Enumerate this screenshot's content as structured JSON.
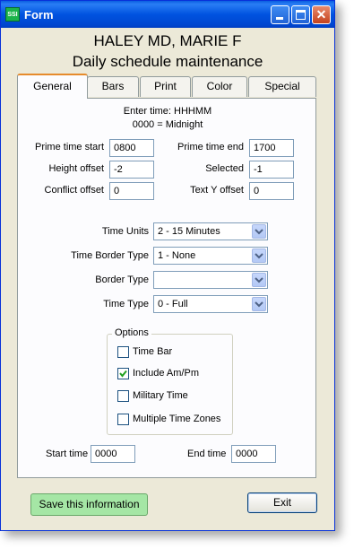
{
  "window": {
    "title": "Form",
    "app_icon": "SSI"
  },
  "header": {
    "patient": "HALEY MD, MARIE F",
    "screen": "Daily schedule maintenance"
  },
  "tabs": [
    "General",
    "Bars",
    "Print",
    "Color",
    "Special"
  ],
  "active_tab": "General",
  "instructions": {
    "line1": "Enter time: HHHMM",
    "line2": "0000 = Midnight"
  },
  "fields": {
    "prime_start": {
      "label": "Prime time start",
      "value": "0800"
    },
    "prime_end": {
      "label": "Prime time end",
      "value": "1700"
    },
    "height_offset": {
      "label": "Height offset",
      "value": "-2"
    },
    "selected": {
      "label": "Selected",
      "value": "-1"
    },
    "conflict_offset": {
      "label": "Conflict offset",
      "value": "0"
    },
    "text_y_offset": {
      "label": "Text Y offset",
      "value": "0"
    }
  },
  "dropdowns": {
    "time_units": {
      "label": "Time Units",
      "value": "2 - 15 Minutes"
    },
    "time_border_type": {
      "label": "Time Border Type",
      "value": "1 - None"
    },
    "border_type": {
      "label": "Border Type",
      "value": ""
    },
    "time_type": {
      "label": "Time Type",
      "value": "0 - Full"
    }
  },
  "options": {
    "legend": "Options",
    "items": [
      {
        "label": "Time Bar",
        "checked": false
      },
      {
        "label": "Include Am/Pm",
        "checked": true
      },
      {
        "label": "Military Time",
        "checked": false
      },
      {
        "label": "Multiple Time Zones",
        "checked": false
      }
    ]
  },
  "start_time": {
    "label": "Start time",
    "value": "0000"
  },
  "end_time": {
    "label": "End time",
    "value": "0000"
  },
  "buttons": {
    "save": "Save this information",
    "exit": "Exit"
  },
  "colors": {
    "title_bar": "#0053e0",
    "window_bg": "#ece9d8",
    "active_tab_accent": "#e68b2c",
    "save_button_bg": "#a5e6a5"
  }
}
